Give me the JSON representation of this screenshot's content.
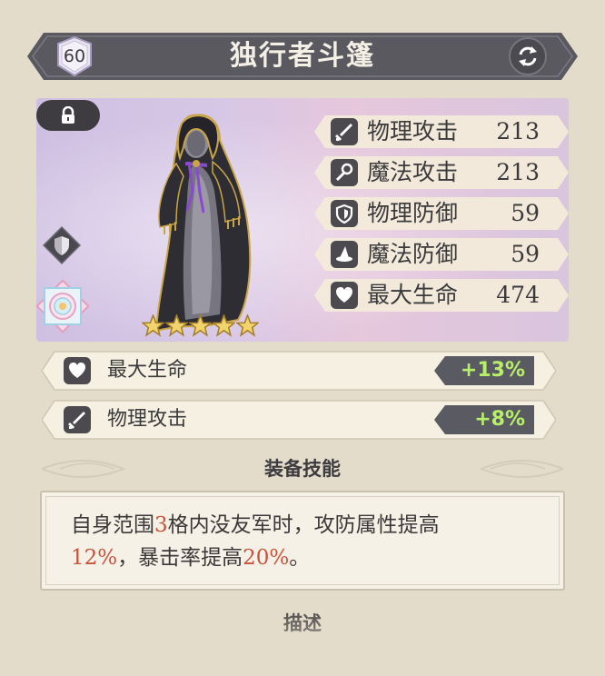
{
  "header": {
    "level": "60",
    "title": "独行者斗篷",
    "swap_icon": "swap-icon"
  },
  "portrait": {
    "stars": 5,
    "lock_icon": "lock-icon",
    "shield_icon": "shield-icon",
    "emblem_icon": "flower-emblem-icon"
  },
  "stats": [
    {
      "icon": "sword-icon",
      "label": "物理攻击",
      "value": "213"
    },
    {
      "icon": "wand-icon",
      "label": "魔法攻击",
      "value": "213"
    },
    {
      "icon": "shield-icon",
      "label": "物理防御",
      "value": "59"
    },
    {
      "icon": "witch-hat-icon",
      "label": "魔法防御",
      "value": "59"
    },
    {
      "icon": "heart-icon",
      "label": "最大生命",
      "value": "474"
    }
  ],
  "bonuses": [
    {
      "icon": "heart-icon",
      "label": "最大生命",
      "value": "+13%"
    },
    {
      "icon": "sword-icon",
      "label": "物理攻击",
      "value": "+8%"
    }
  ],
  "skill": {
    "heading": "装备技能",
    "text_1": "自身范围",
    "hl_1": "3",
    "text_2": "格内没友军时，攻防属性提高",
    "hl_2": "12%",
    "text_3": "，暴击率提高",
    "hl_3": "20%",
    "text_4": "。"
  },
  "description": {
    "heading": "描述"
  },
  "colors": {
    "background": "#e4dccb",
    "banner": "#57565c",
    "bonus_green": "#b8ef6a",
    "highlight": "#c8533c"
  }
}
